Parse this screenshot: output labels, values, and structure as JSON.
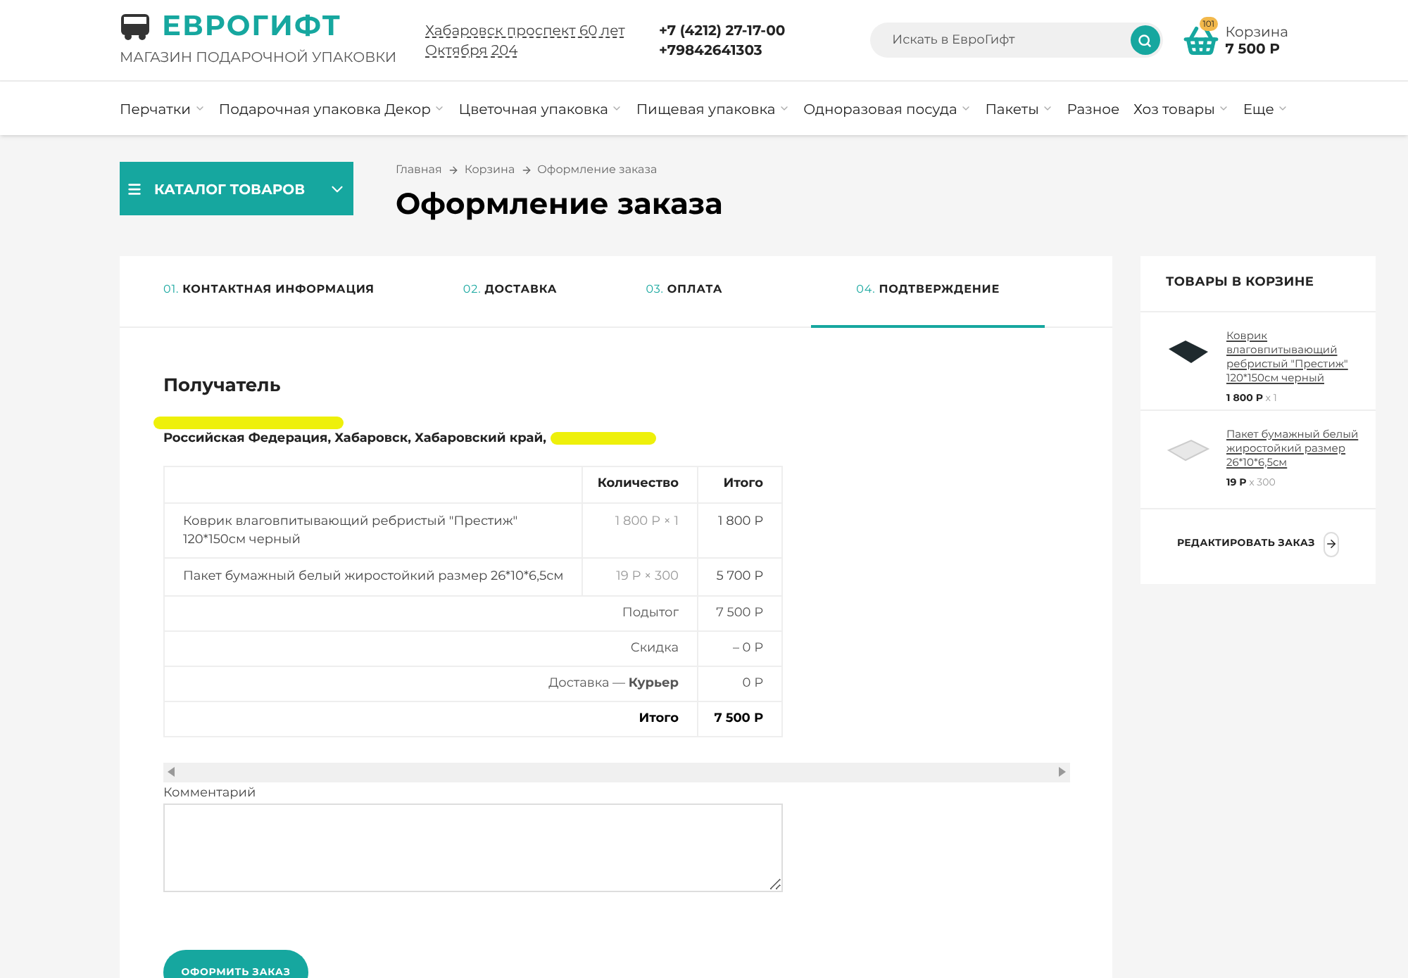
{
  "header": {
    "logo": "ЕВРОГИФТ",
    "tagline": "МАГАЗИН ПОДАРОЧНОЙ УПАКОВКИ",
    "address": "Хабаровск проспект 60 лет Октября 204",
    "phones": [
      "+7 (4212) 27-17-00",
      "+79842641303"
    ],
    "search": {
      "placeholder": "Искать в ЕвроГифт"
    },
    "cart": {
      "badge": "101",
      "label": "Корзина",
      "total": "7 500 Р"
    }
  },
  "nav": [
    {
      "label": "Перчатки",
      "dropdown": true
    },
    {
      "label": "Подарочная упаковка Декор",
      "dropdown": true
    },
    {
      "label": "Цветочная упаковка",
      "dropdown": true
    },
    {
      "label": "Пищевая упаковка",
      "dropdown": true
    },
    {
      "label": "Одноразовая посуда",
      "dropdown": true
    },
    {
      "label": "Пакеты",
      "dropdown": true
    },
    {
      "label": "Разное",
      "dropdown": false
    },
    {
      "label": "Хоз товары",
      "dropdown": true
    },
    {
      "label": "Еще",
      "dropdown": true
    }
  ],
  "catalog_button": "КАТАЛОГ ТОВАРОВ",
  "breadcrumbs": [
    "Главная",
    "Корзина",
    "Оформление заказа"
  ],
  "page_title": "Оформление заказа",
  "steps": [
    {
      "number": "01.",
      "label": "КОНТАКТНАЯ ИНФОРМАЦИЯ",
      "selected": false
    },
    {
      "number": "02.",
      "label": "ДОСТАВКА",
      "selected": false
    },
    {
      "number": "03.",
      "label": "ОПЛАТА",
      "selected": false
    },
    {
      "number": "04.",
      "label": "ПОДТВЕРЖДЕНИЕ",
      "selected": true
    }
  ],
  "recipient": {
    "heading": "Получатель",
    "address": "Российская Федерация, Хабаровск, Хабаровский край, "
  },
  "order_table": {
    "columns": [
      "Количество",
      "Итого"
    ],
    "items": [
      {
        "name": "Коврик влаговпитывающий ребристый \"Престиж\" 120*150см черный",
        "quantity": "1 800 Р × 1",
        "total": "1 800 Р"
      },
      {
        "name": "Пакет бумажный белый жиростойкий размер 26*10*6,5см",
        "quantity": "19 Р × 300",
        "total": "5 700 Р"
      }
    ],
    "summary": [
      {
        "label": "Подытог",
        "total": "7 500 Р",
        "bold": false
      },
      {
        "label": "Скидка",
        "total": "– 0 Р",
        "bold": false
      },
      {
        "label": "Доставка — **Курьер**",
        "total": "0 Р",
        "bold": false
      },
      {
        "label": "Итого",
        "total": "7 500 Р",
        "bold": true
      }
    ]
  },
  "comment": {
    "label": "Комментарий"
  },
  "submit_button": "ОФОРМИТЬ ЗАКАЗ",
  "sidebar": {
    "title": "ТОВАРЫ В КОРЗИНЕ",
    "items": [
      {
        "kind": "dark",
        "name": "Коврик влаговпитывающий ребристый \"Престиж\" 120*150см черный",
        "price": "1 800 Р",
        "qty": "x 1"
      },
      {
        "kind": "light",
        "name": "Пакет бумажный белый жиростойкий размер 26*10*6,5см",
        "price": "19 Р",
        "qty": "x 300"
      }
    ],
    "edit_link": "РЕДАКТИРОВАТЬ ЗАКАЗ"
  }
}
